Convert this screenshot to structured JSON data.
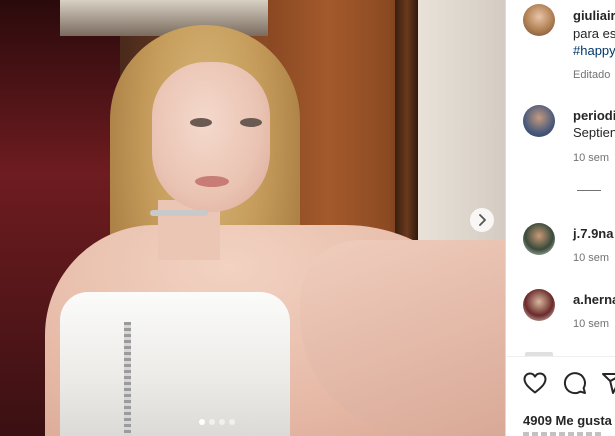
{
  "post": {
    "photo_alt": "",
    "image_count": 4,
    "active_index": 0
  },
  "caption": {
    "username": "giuliair",
    "text": "para es",
    "hashtag": "#happy",
    "meta": "Editado"
  },
  "comments": [
    {
      "username": "periodi",
      "text": "Septien",
      "time": "10 sem"
    },
    {
      "username": "j.7.9na",
      "time": "10 sem"
    },
    {
      "username": "a.herna",
      "time": "10 sem"
    }
  ],
  "actions": {
    "like_icon": "heart-icon",
    "comment_icon": "comment-icon",
    "share_icon": "share-icon"
  },
  "likes_text": "4909 Me gusta"
}
